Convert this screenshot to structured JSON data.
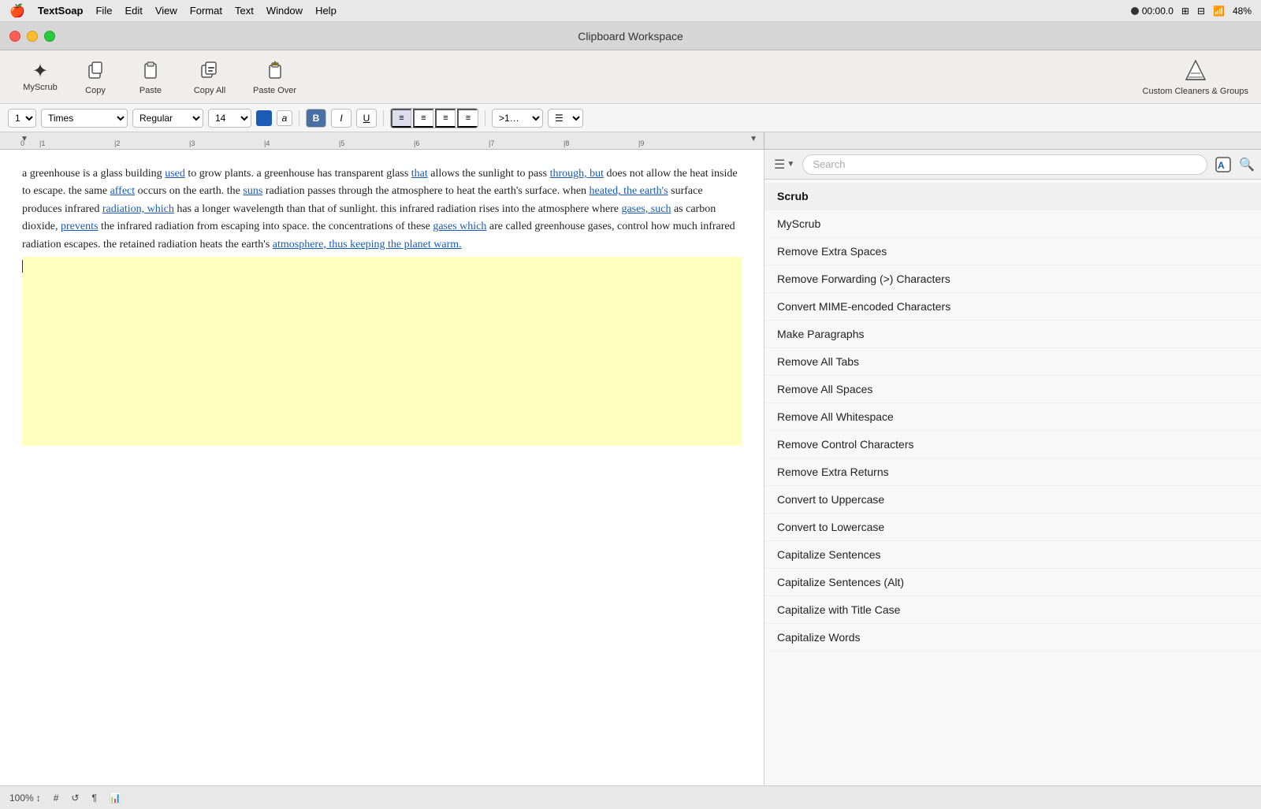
{
  "app": {
    "name": "TextSoap",
    "title": "Clipboard Workspace"
  },
  "menubar": {
    "apple": "🍎",
    "items": [
      "TextSoap",
      "File",
      "Edit",
      "View",
      "Format",
      "Text",
      "Window",
      "Help"
    ],
    "right": {
      "record": "00:00.0",
      "battery": "48%"
    }
  },
  "toolbar": {
    "buttons": [
      {
        "id": "myscrub",
        "label": "MyScrub",
        "icon": "✦"
      },
      {
        "id": "copy",
        "label": "Copy",
        "icon": "⊡"
      },
      {
        "id": "paste",
        "label": "Paste",
        "icon": "📋"
      },
      {
        "id": "copy-all",
        "label": "Copy All",
        "icon": "📄"
      },
      {
        "id": "paste-over",
        "label": "Paste Over",
        "icon": "⬆"
      }
    ],
    "custom_label": "Custom Cleaners & Groups"
  },
  "formatbar": {
    "zoom_label": "1↕",
    "font": "Times",
    "style": "Regular",
    "size": "14",
    "bold": "B",
    "italic": "I",
    "underline": "U",
    "more_dropdown": ">1…",
    "list_dropdown": "≡"
  },
  "text_content": {
    "paragraph": "a greenhouse is a glass building used to grow plants. a greenhouse has transparent glass that allows the sunlight to pass through, but does not allow the heat inside to escape. the same affect occurs on the earth. the suns radiation passes through the atmosphere to heat the earth's surface. when heated, the earth's surface produces infrared radiation, which has a longer wavelength than that of sunlight. this infrared radiation rises into the atmosphere where gases, such as carbon dioxide, prevents the infrared radiation from escaping into space. the concentrations of these gases which are called greenhouse gases, control how much infrared radiation escapes. the retained radiation heats the earth's atmosphere, thus keeping the planet warm.",
    "links": [
      "used",
      "that",
      "through, but",
      "affect",
      "suns",
      "heated, the earth's",
      "radiation, which",
      "gases, such",
      "prevents",
      "gases which",
      "atmosphere, thus keeping the planet warm."
    ]
  },
  "panel": {
    "search_placeholder": "Search",
    "items": [
      {
        "id": "scrub",
        "label": "Scrub",
        "is_header": true
      },
      {
        "id": "myscrub",
        "label": "MyScrub",
        "is_header": false
      },
      {
        "id": "remove-extra-spaces",
        "label": "Remove Extra Spaces",
        "is_header": false
      },
      {
        "id": "remove-forwarding",
        "label": "Remove Forwarding (>) Characters",
        "is_header": false
      },
      {
        "id": "convert-mime",
        "label": "Convert MIME-encoded Characters",
        "is_header": false
      },
      {
        "id": "make-paragraphs",
        "label": "Make Paragraphs",
        "is_header": false
      },
      {
        "id": "remove-all-tabs",
        "label": "Remove All Tabs",
        "is_header": false
      },
      {
        "id": "remove-all-spaces",
        "label": "Remove All Spaces",
        "is_header": false
      },
      {
        "id": "remove-all-whitespace",
        "label": "Remove All Whitespace",
        "is_header": false
      },
      {
        "id": "remove-control-chars",
        "label": "Remove Control Characters",
        "is_header": false
      },
      {
        "id": "remove-extra-returns",
        "label": "Remove Extra Returns",
        "is_header": false
      },
      {
        "id": "convert-uppercase",
        "label": "Convert to Uppercase",
        "is_header": false
      },
      {
        "id": "convert-lowercase",
        "label": "Convert to Lowercase",
        "is_header": false
      },
      {
        "id": "capitalize-sentences",
        "label": "Capitalize Sentences",
        "is_header": false
      },
      {
        "id": "capitalize-sentences-alt",
        "label": "Capitalize Sentences (Alt)",
        "is_header": false
      },
      {
        "id": "capitalize-title-case",
        "label": "Capitalize with Title Case",
        "is_header": false
      },
      {
        "id": "capitalize-words",
        "label": "Capitalize Words",
        "is_header": false
      }
    ]
  },
  "statusbar": {
    "zoom": "100%",
    "zoom_icon": "↕",
    "hash_icon": "#",
    "undo_icon": "↺",
    "para_icon": "¶",
    "chart_icon": "📊"
  }
}
